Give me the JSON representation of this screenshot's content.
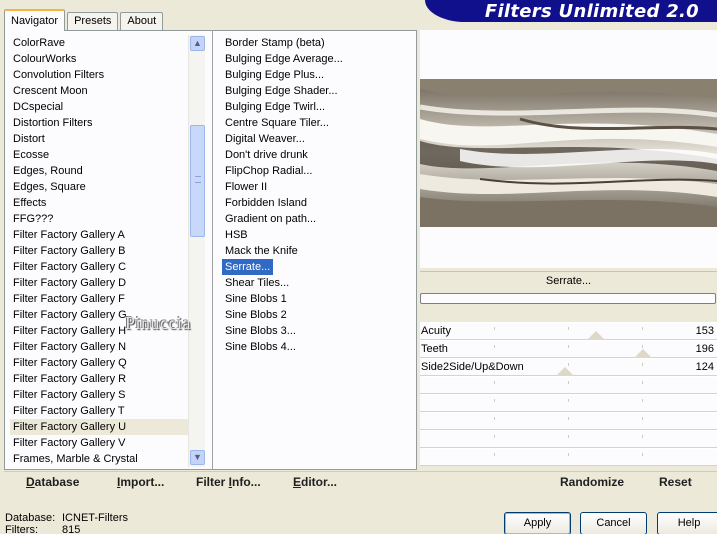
{
  "banner": {
    "title": "Filters Unlimited 2.0"
  },
  "tabs": [
    {
      "label": "Navigator",
      "active": true
    },
    {
      "label": "Presets",
      "active": false
    },
    {
      "label": "About",
      "active": false
    }
  ],
  "categories": [
    "ColorRave",
    "ColourWorks",
    "Convolution Filters",
    "Crescent Moon",
    "DCspecial",
    "Distortion Filters",
    "Distort",
    "Ecosse",
    "Edges, Round",
    "Edges, Square",
    "Effects",
    "FFG???",
    "Filter Factory Gallery A",
    "Filter Factory Gallery B",
    "Filter Factory Gallery C",
    "Filter Factory Gallery D",
    "Filter Factory Gallery F",
    "Filter Factory Gallery G",
    "Filter Factory Gallery H",
    "Filter Factory Gallery N",
    "Filter Factory Gallery Q",
    "Filter Factory Gallery R",
    "Filter Factory Gallery S",
    "Filter Factory Gallery T",
    "Filter Factory Gallery U",
    "Filter Factory Gallery V",
    "Frames, Marble & Crystal"
  ],
  "selected_category": "Filter Factory Gallery U",
  "filters": [
    "Border Stamp (beta)",
    "Bulging Edge Average...",
    "Bulging Edge Plus...",
    "Bulging Edge Shader...",
    "Bulging Edge Twirl...",
    "Centre Square Tiler...",
    "Digital Weaver...",
    "Don't drive drunk",
    "FlipChop Radial...",
    "Flower II",
    "Forbidden Island",
    "Gradient on path...",
    "HSB",
    "Mack the Knife",
    "Serrate...",
    "Shear Tiles...",
    "Sine Blobs 1",
    "Sine Blobs 2",
    "Sine Blobs 3...",
    "Sine Blobs 4..."
  ],
  "selected_filter": "Serrate...",
  "watermark": "Pinuccia",
  "preview": {
    "filter_name": "Serrate...",
    "progress": 0
  },
  "sliders": [
    {
      "label": "Acuity",
      "value": 153,
      "max": 255
    },
    {
      "label": "Teeth",
      "value": 196,
      "max": 255
    },
    {
      "label": "Side2Side/Up&Down",
      "value": 124,
      "max": 255
    }
  ],
  "toolbar": {
    "database": {
      "first": "D",
      "rest": "atabase"
    },
    "import": {
      "first": "I",
      "rest": "mport..."
    },
    "filter_info": {
      "pre": "Filter ",
      "first": "I",
      "rest": "nfo..."
    },
    "editor": {
      "first": "E",
      "rest": "ditor..."
    },
    "randomize": "Randomize",
    "reset": "Reset"
  },
  "status": {
    "database_key": "Database:",
    "database_value": "ICNET-Filters",
    "filters_key": "Filters:",
    "filters_value": "815"
  },
  "buttons": {
    "apply": "Apply",
    "cancel": "Cancel",
    "help": "Help"
  },
  "icons": {
    "scroll_up": "chevron-up-icon",
    "scroll_down": "chevron-down-icon"
  }
}
